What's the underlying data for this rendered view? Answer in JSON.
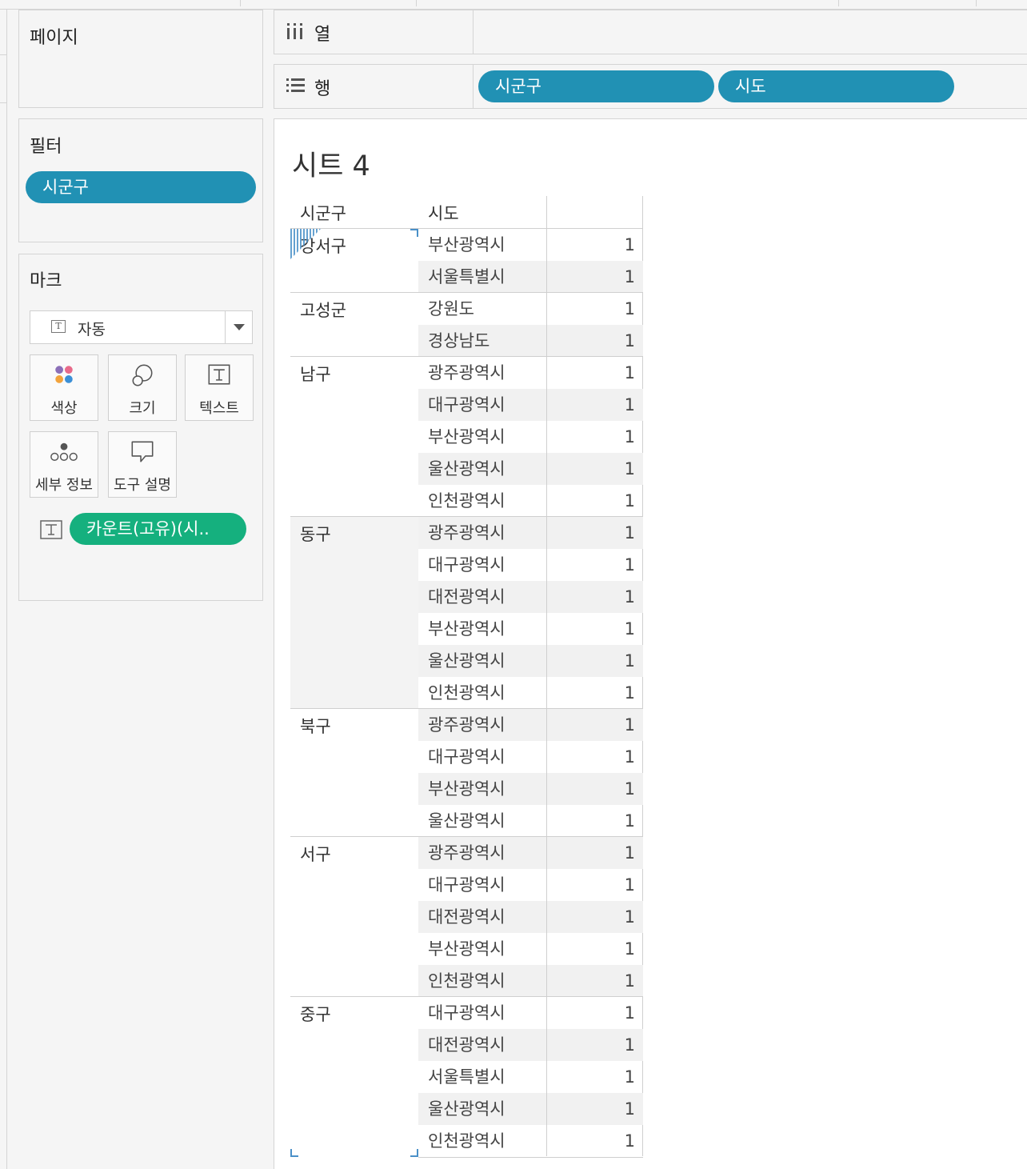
{
  "panels": {
    "pages": {
      "title": "페이지"
    },
    "filters": {
      "title": "필터",
      "items": [
        "시군구"
      ]
    },
    "marks": {
      "title": "마크",
      "mark_type": "자동",
      "buttons": {
        "color": "색상",
        "size": "크기",
        "text": "텍스트",
        "detail": "세부 정보",
        "tooltip": "도구 설명"
      },
      "field_pill": "카운트(고유)(시.."
    }
  },
  "shelves": {
    "columns": {
      "label": "열",
      "pills": []
    },
    "rows": {
      "label": "행",
      "pills": [
        "시군구",
        "시도"
      ]
    }
  },
  "sheet": {
    "title": "시트 4",
    "headers": {
      "col1": "시군구",
      "col2": "시도"
    },
    "groups": [
      {
        "label": "강서구",
        "rows": [
          {
            "sido": "부산광역시",
            "value": "1"
          },
          {
            "sido": "서울특별시",
            "value": "1"
          }
        ]
      },
      {
        "label": "고성군",
        "rows": [
          {
            "sido": "강원도",
            "value": "1"
          },
          {
            "sido": "경상남도",
            "value": "1"
          }
        ]
      },
      {
        "label": "남구",
        "rows": [
          {
            "sido": "광주광역시",
            "value": "1"
          },
          {
            "sido": "대구광역시",
            "value": "1"
          },
          {
            "sido": "부산광역시",
            "value": "1"
          },
          {
            "sido": "울산광역시",
            "value": "1"
          },
          {
            "sido": "인천광역시",
            "value": "1"
          }
        ]
      },
      {
        "label": "동구",
        "rows": [
          {
            "sido": "광주광역시",
            "value": "1"
          },
          {
            "sido": "대구광역시",
            "value": "1"
          },
          {
            "sido": "대전광역시",
            "value": "1"
          },
          {
            "sido": "부산광역시",
            "value": "1"
          },
          {
            "sido": "울산광역시",
            "value": "1"
          },
          {
            "sido": "인천광역시",
            "value": "1"
          }
        ]
      },
      {
        "label": "북구",
        "rows": [
          {
            "sido": "광주광역시",
            "value": "1"
          },
          {
            "sido": "대구광역시",
            "value": "1"
          },
          {
            "sido": "부산광역시",
            "value": "1"
          },
          {
            "sido": "울산광역시",
            "value": "1"
          }
        ]
      },
      {
        "label": "서구",
        "rows": [
          {
            "sido": "광주광역시",
            "value": "1"
          },
          {
            "sido": "대구광역시",
            "value": "1"
          },
          {
            "sido": "대전광역시",
            "value": "1"
          },
          {
            "sido": "부산광역시",
            "value": "1"
          },
          {
            "sido": "인천광역시",
            "value": "1"
          }
        ]
      },
      {
        "label": "중구",
        "rows": [
          {
            "sido": "대구광역시",
            "value": "1"
          },
          {
            "sido": "대전광역시",
            "value": "1"
          },
          {
            "sido": "서울특별시",
            "value": "1"
          },
          {
            "sido": "울산광역시",
            "value": "1"
          },
          {
            "sido": "인천광역시",
            "value": "1"
          }
        ]
      }
    ]
  },
  "colors": {
    "pill_blue": "#2191b4",
    "pill_green": "#15b07e",
    "selection": "#4a90c8"
  }
}
